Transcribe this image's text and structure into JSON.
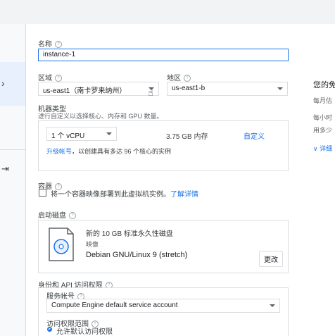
{
  "form": {
    "name_label": "名称",
    "name_value": "instance-1",
    "region_label": "区域",
    "region_value": "us-east1（南卡罗来纳州）",
    "zone_label": "地区",
    "zone_value": "us-east1-b",
    "machine_type_label": "机器类型",
    "machine_type_sub": "进行自定义以选择核心、内存和 GPU 数量。",
    "vcpu_value": "1 个 vCPU",
    "memory_text": "3.75 GB 内存",
    "customize_link": "自定义",
    "upgrade_link": "升级帐号",
    "upgrade_text": "，以创建具有多达 96 个核心的实例",
    "container_label": "容器",
    "container_checkbox_text": "将一个容器映像部署到此虚拟机实例。",
    "learn_more_link": "了解详情",
    "boot_disk_label": "启动磁盘",
    "disk_title": "新的 10 GB 标准永久性磁盘",
    "disk_image_label": "映像",
    "disk_image_value": "Debian GNU/Linux 9 (stretch)",
    "change_button": "更改",
    "identity_label": "身份和 API 访问权限",
    "service_account_label": "服务帐号",
    "service_account_value": "Compute Engine default service account",
    "access_scope_label": "访问权限范围",
    "access_scope_option": "允许默认访问权限"
  },
  "right_panel": {
    "title": "您的免",
    "line1": "每月估",
    "line2": "每小时",
    "line3": "用多少",
    "details": "详细"
  },
  "colors": {
    "accent": "#1a73e8",
    "nav_bg": "#f8f9fa",
    "nav_active": "#e8f0fe"
  }
}
